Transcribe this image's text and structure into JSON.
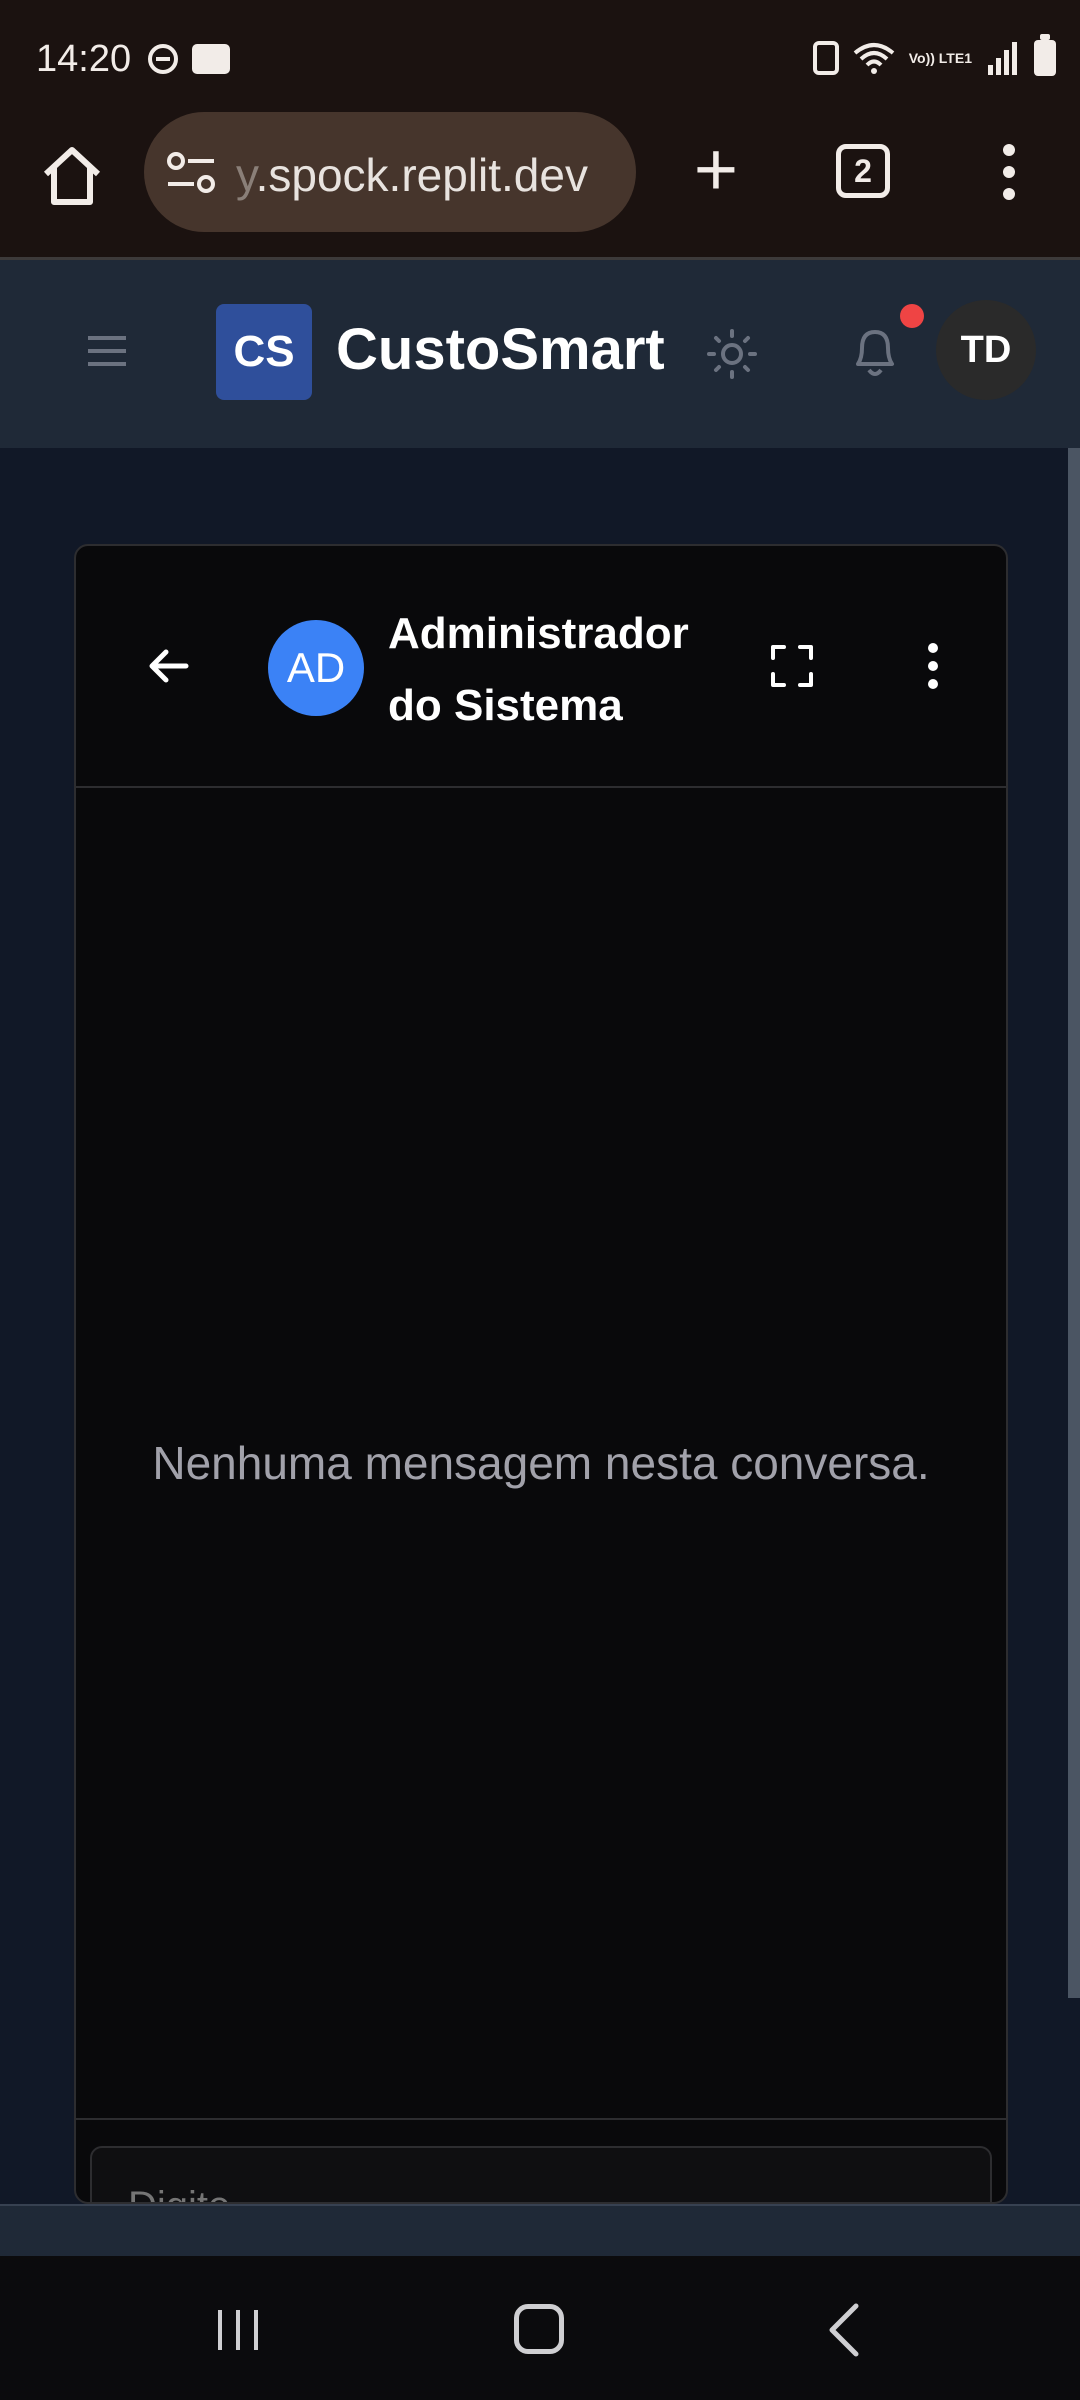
{
  "status_bar": {
    "time": "14:20",
    "network": "Vo)) LTE1"
  },
  "browser": {
    "url_fade": "y",
    "url": ".spock.replit.dev",
    "tab_count": "2"
  },
  "app": {
    "logo": "CS",
    "title": "CustoSmart",
    "user_initials": "TD"
  },
  "chat": {
    "contact_initials": "AD",
    "contact_name": "Administrador do Sistema",
    "empty_message": "Nenhuma mensagem nesta conversa.",
    "input_placeholder": "Digite..."
  },
  "colors": {
    "accent": "#3b82f6",
    "logo_bg": "#2f4f9b",
    "notification": "#ef4444",
    "header_bg": "#1f2937",
    "card_bg": "#09090b"
  }
}
